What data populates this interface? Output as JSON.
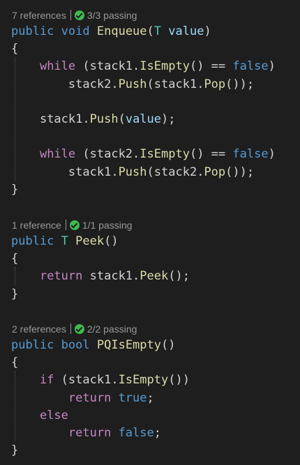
{
  "theme": {
    "background": "#1e1e1e",
    "keyword_color": "#569cd6",
    "control_keyword_color": "#c586c0",
    "method_color": "#dcdcaa",
    "type_color": "#4ec9b0",
    "parameter_color": "#9cdcfe",
    "text_color": "#d4d4d4",
    "codelens_color": "#999999",
    "pass_icon_color": "#3fb950"
  },
  "methods": [
    {
      "codelens": {
        "references": "7 references",
        "tests": "3/3 passing",
        "icon": "check-circle-icon"
      },
      "lines": [
        [
          [
            "public",
            "kw"
          ],
          [
            " ",
            "pn"
          ],
          [
            "void",
            "kw"
          ],
          [
            " ",
            "pn"
          ],
          [
            "Enqueue",
            "fn"
          ],
          [
            "(",
            "pn"
          ],
          [
            "T",
            "tp"
          ],
          [
            " ",
            "pn"
          ],
          [
            "value",
            "par"
          ],
          [
            ")",
            "pn"
          ]
        ],
        [
          [
            "{",
            "pn"
          ]
        ],
        [
          [
            "    ",
            "pn"
          ],
          [
            "while",
            "ctl"
          ],
          [
            " (",
            "pn"
          ],
          [
            "stack1",
            "id"
          ],
          [
            ".",
            "pn"
          ],
          [
            "IsEmpty",
            "fn"
          ],
          [
            "() == ",
            "pn"
          ],
          [
            "false",
            "kw"
          ],
          [
            ")",
            "pn"
          ]
        ],
        [
          [
            "        ",
            "pn"
          ],
          [
            "stack2",
            "id"
          ],
          [
            ".",
            "pn"
          ],
          [
            "Push",
            "fn"
          ],
          [
            "(",
            "pn"
          ],
          [
            "stack1",
            "id"
          ],
          [
            ".",
            "pn"
          ],
          [
            "Pop",
            "fn"
          ],
          [
            "());",
            "pn"
          ]
        ],
        [],
        [
          [
            "    ",
            "pn"
          ],
          [
            "stack1",
            "id"
          ],
          [
            ".",
            "pn"
          ],
          [
            "Push",
            "fn"
          ],
          [
            "(",
            "pn"
          ],
          [
            "value",
            "par"
          ],
          [
            ");",
            "pn"
          ]
        ],
        [],
        [
          [
            "    ",
            "pn"
          ],
          [
            "while",
            "ctl"
          ],
          [
            " (",
            "pn"
          ],
          [
            "stack2",
            "id"
          ],
          [
            ".",
            "pn"
          ],
          [
            "IsEmpty",
            "fn"
          ],
          [
            "() == ",
            "pn"
          ],
          [
            "false",
            "kw"
          ],
          [
            ")",
            "pn"
          ]
        ],
        [
          [
            "        ",
            "pn"
          ],
          [
            "stack1",
            "id"
          ],
          [
            ".",
            "pn"
          ],
          [
            "Push",
            "fn"
          ],
          [
            "(",
            "pn"
          ],
          [
            "stack2",
            "id"
          ],
          [
            ".",
            "pn"
          ],
          [
            "Pop",
            "fn"
          ],
          [
            "());",
            "pn"
          ]
        ],
        [
          [
            "}",
            "pn"
          ]
        ]
      ]
    },
    {
      "codelens": {
        "references": "1 reference",
        "tests": "1/1 passing",
        "icon": "check-circle-icon"
      },
      "lines": [
        [
          [
            "public",
            "kw"
          ],
          [
            " ",
            "pn"
          ],
          [
            "T",
            "tp"
          ],
          [
            " ",
            "pn"
          ],
          [
            "Peek",
            "fn"
          ],
          [
            "()",
            "pn"
          ]
        ],
        [
          [
            "{",
            "pn"
          ]
        ],
        [
          [
            "    ",
            "pn"
          ],
          [
            "return",
            "ctl"
          ],
          [
            " ",
            "pn"
          ],
          [
            "stack1",
            "id"
          ],
          [
            ".",
            "pn"
          ],
          [
            "Peek",
            "fn"
          ],
          [
            "();",
            "pn"
          ]
        ],
        [
          [
            "}",
            "pn"
          ]
        ]
      ]
    },
    {
      "codelens": {
        "references": "2 references",
        "tests": "2/2 passing",
        "icon": "check-circle-icon"
      },
      "lines": [
        [
          [
            "public",
            "kw"
          ],
          [
            " ",
            "pn"
          ],
          [
            "bool",
            "kw"
          ],
          [
            " ",
            "pn"
          ],
          [
            "PQIsEmpty",
            "fn"
          ],
          [
            "()",
            "pn"
          ]
        ],
        [
          [
            "{",
            "pn"
          ]
        ],
        [
          [
            "    ",
            "pn"
          ],
          [
            "if",
            "ctl"
          ],
          [
            " (",
            "pn"
          ],
          [
            "stack1",
            "id"
          ],
          [
            ".",
            "pn"
          ],
          [
            "IsEmpty",
            "fn"
          ],
          [
            "())",
            "pn"
          ]
        ],
        [
          [
            "        ",
            "pn"
          ],
          [
            "return",
            "ctl"
          ],
          [
            " ",
            "pn"
          ],
          [
            "true",
            "kw"
          ],
          [
            ";",
            "pn"
          ]
        ],
        [
          [
            "    ",
            "pn"
          ],
          [
            "else",
            "ctl"
          ]
        ],
        [
          [
            "        ",
            "pn"
          ],
          [
            "return",
            "ctl"
          ],
          [
            " ",
            "pn"
          ],
          [
            "false",
            "kw"
          ],
          [
            ";",
            "pn"
          ]
        ],
        [
          [
            "}",
            "pn"
          ]
        ]
      ]
    }
  ]
}
